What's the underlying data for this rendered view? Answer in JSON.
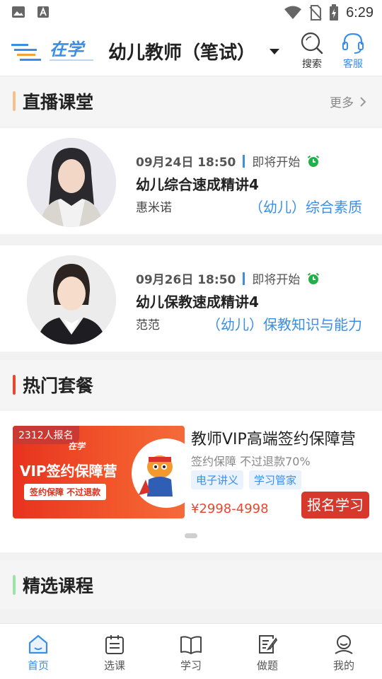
{
  "status_bar": {
    "time": "6:29",
    "left_icons": [
      "image-icon",
      "font-icon"
    ],
    "right_icons": [
      "wifi-icon",
      "no-sim-icon",
      "battery-icon"
    ]
  },
  "header": {
    "logo_text": "在学",
    "exam_title": "幼儿教师（笔试）",
    "search_label": "搜索",
    "service_label": "客服"
  },
  "live_section": {
    "title": "直播课堂",
    "more_label": "更多",
    "bar_color": "#f5c18a",
    "items": [
      {
        "datetime": "09月24日 18:50",
        "status": "即将开始",
        "title": "幼儿综合速成精讲4",
        "teacher": "惠米诺",
        "subject": "（幼儿）综合素质"
      },
      {
        "datetime": "09月26日 18:50",
        "status": "即将开始",
        "title": "幼儿保教速成精讲4",
        "teacher": "范范",
        "subject": "（幼儿）保教知识与能力"
      }
    ]
  },
  "package_section": {
    "title": "热门套餐",
    "bar_color": "#e8472f",
    "package": {
      "enroll_count": "2312人报名",
      "banner_logo": "在学",
      "banner_title": "VIP签约保障营",
      "banner_sub": "签约保障 不过退款",
      "title": "教师VIP高端签约保障营",
      "subtitle": "签约保障  不过退款70%",
      "tags": [
        "电子讲义",
        "学习管家"
      ],
      "price": "¥2998-4998",
      "button_label": "报名学习"
    }
  },
  "featured_section": {
    "title": "精选课程",
    "bar_color": "#9be3a8"
  },
  "tabbar": {
    "active_color": "#3a8ee6",
    "items": [
      {
        "label": "首页",
        "icon": "home-icon",
        "active": true
      },
      {
        "label": "选课",
        "icon": "course-select-icon",
        "active": false
      },
      {
        "label": "学习",
        "icon": "book-icon",
        "active": false
      },
      {
        "label": "做题",
        "icon": "exercise-icon",
        "active": false
      },
      {
        "label": "我的",
        "icon": "profile-icon",
        "active": false
      }
    ]
  }
}
